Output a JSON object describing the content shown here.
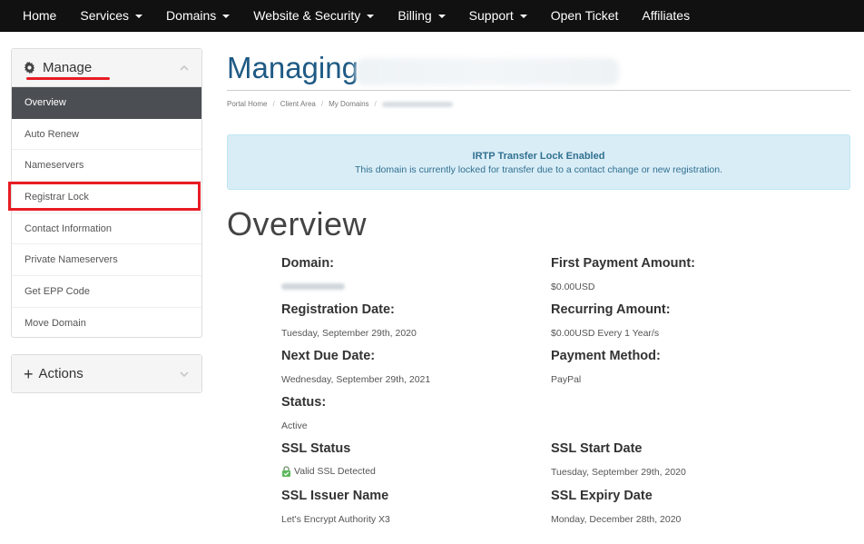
{
  "nav": {
    "items": [
      {
        "label": "Home",
        "dropdown": false
      },
      {
        "label": "Services",
        "dropdown": true
      },
      {
        "label": "Domains",
        "dropdown": true
      },
      {
        "label": "Website & Security",
        "dropdown": true
      },
      {
        "label": "Billing",
        "dropdown": true
      },
      {
        "label": "Support",
        "dropdown": true
      },
      {
        "label": "Open Ticket",
        "dropdown": false
      },
      {
        "label": "Affiliates",
        "dropdown": false
      }
    ]
  },
  "sidebar": {
    "manage_title": "Manage",
    "items": [
      {
        "label": "Overview",
        "active": true
      },
      {
        "label": "Auto Renew",
        "active": false
      },
      {
        "label": "Nameservers",
        "active": false
      },
      {
        "label": "Registrar Lock",
        "active": false
      },
      {
        "label": "Contact Information",
        "active": false
      },
      {
        "label": "Private Nameservers",
        "active": false
      },
      {
        "label": "Get EPP Code",
        "active": false
      },
      {
        "label": "Move Domain",
        "active": false
      }
    ],
    "actions_title": "Actions"
  },
  "main": {
    "title": "Managing",
    "breadcrumb": [
      "Portal Home",
      "Client Area",
      "My Domains"
    ],
    "alert": {
      "title": "IRTP Transfer Lock Enabled",
      "text": "This domain is currently locked for transfer due to a contact change or new registration."
    },
    "overview_heading": "Overview",
    "details": {
      "domain_label": "Domain:",
      "registration_date_label": "Registration Date:",
      "registration_date": "Tuesday, September 29th, 2020",
      "next_due_date_label": "Next Due Date:",
      "next_due_date": "Wednesday, September 29th, 2021",
      "status_label": "Status:",
      "status": "Active",
      "ssl_status_label": "SSL Status",
      "ssl_status": "Valid SSL Detected",
      "ssl_issuer_label": "SSL Issuer Name",
      "ssl_issuer": "Let's Encrypt Authority X3",
      "first_payment_label": "First Payment Amount:",
      "first_payment": "$0.00USD",
      "recurring_label": "Recurring Amount:",
      "recurring": "$0.00USD Every 1 Year/s",
      "payment_method_label": "Payment Method:",
      "payment_method": "PayPal",
      "ssl_start_label": "SSL Start Date",
      "ssl_start": "Tuesday, September 29th, 2020",
      "ssl_expiry_label": "SSL Expiry Date",
      "ssl_expiry": "Monday, December 28th, 2020"
    }
  },
  "colors": {
    "navbar_bg": "#111111",
    "title_blue": "#1f5a84",
    "active_item_bg": "#4b4f54",
    "alert_bg": "#d9edf7",
    "alert_text": "#31708f",
    "highlight_red": "#e81c24",
    "ssl_ok_green": "#5cb85c"
  },
  "icons": {
    "manage": "gear-icon",
    "manage_toggle": "chevron-up-icon",
    "actions": "plus-icon",
    "actions_toggle": "chevron-down-icon",
    "ssl": "lock-icon"
  }
}
